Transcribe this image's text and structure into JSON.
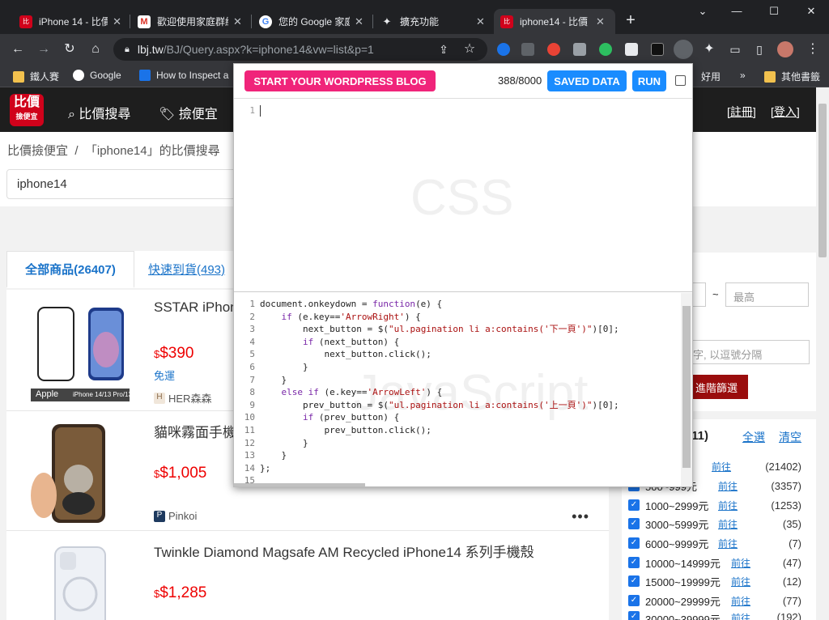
{
  "browser": {
    "tabs": [
      {
        "title": "iPhone 14 - 比價",
        "color": "#d0021b",
        "glyph": "比"
      },
      {
        "title": "歡迎使用家庭群組",
        "color": "#ffffff",
        "glyph": "M"
      },
      {
        "title": "您的 Google 家庭",
        "color": "#ffffff",
        "glyph": "G"
      },
      {
        "title": "擴充功能",
        "color": "#9aa0a6",
        "glyph": "✦"
      },
      {
        "title": "iphone14 - 比價",
        "color": "#d0021b",
        "glyph": "比"
      }
    ],
    "url_host": "lbj.tw",
    "url_path": "/BJ/Query.aspx?k=iphone14&vw=list&p=1",
    "bookmarks": [
      "鐵人賽",
      "Google",
      "How to Inspect a",
      "好用",
      "其他書籤"
    ]
  },
  "site": {
    "logo_top": "比價",
    "logo_bottom": "撿便宜",
    "nav_search": "比價搜尋",
    "nav_deals": "撿便宜",
    "register": "[註冊]",
    "login": "[登入]",
    "breadcrumb_home": "比價撿便宜",
    "breadcrumb_sep": "/",
    "breadcrumb_current": "「iphone14」的比價搜尋",
    "search_value": "iphone14",
    "tab_all": "全部商品(26407)",
    "tab_fast": "快速到貨(493)"
  },
  "products": [
    {
      "name": "SSTAR iPhone",
      "price": "$390",
      "currency": "$",
      "shipping": "免運",
      "seller": "HER森森",
      "seller_color": "#8a6a4a",
      "image_caption_left": "Apple",
      "image_caption_right": "iPhone 14/13 Pro/13"
    },
    {
      "name": "貓咪霧面手機",
      "price": "$1,005",
      "currency": "$",
      "seller": "Pinkoi",
      "seller_color": "#1e3a5f"
    },
    {
      "name": "Twinkle Diamond Magsafe AM Recycled iPhone14 系列手機殼",
      "price": "$1,285",
      "currency": "$"
    }
  ],
  "filters": {
    "price_tilde": "~",
    "max_placeholder": "最高",
    "keyword_placeholder": "字, 以逗號分隔",
    "advanced_button": "進階篩選",
    "range_heading": "/11)",
    "select_all": "全選",
    "clear": "清空",
    "go_label": "前往",
    "ranges": [
      {
        "label": "",
        "count": "(21402)"
      },
      {
        "label": "500~999元",
        "count": "(3357)"
      },
      {
        "label": "1000~2999元",
        "count": "(1253)"
      },
      {
        "label": "3000~5999元",
        "count": "(35)"
      },
      {
        "label": "6000~9999元",
        "count": "(7)"
      },
      {
        "label": "10000~14999元",
        "count": "(47)"
      },
      {
        "label": "15000~19999元",
        "count": "(12)"
      },
      {
        "label": "20000~29999元",
        "count": "(77)"
      },
      {
        "label": "30000~39999元",
        "count": "(192)"
      }
    ]
  },
  "popup": {
    "wordpress_button": "START YOUR WORDPRESS BLOG",
    "counter": "388/8000",
    "saved_button": "SAVED DATA",
    "run_button": "RUN",
    "css_watermark": "CSS",
    "js_watermark": "JavaScript",
    "css_line_number": "1",
    "js_line_numbers": "1\n2\n3\n4\n5\n6\n7\n8\n9\n10\n11\n12\n13\n14\n15"
  }
}
